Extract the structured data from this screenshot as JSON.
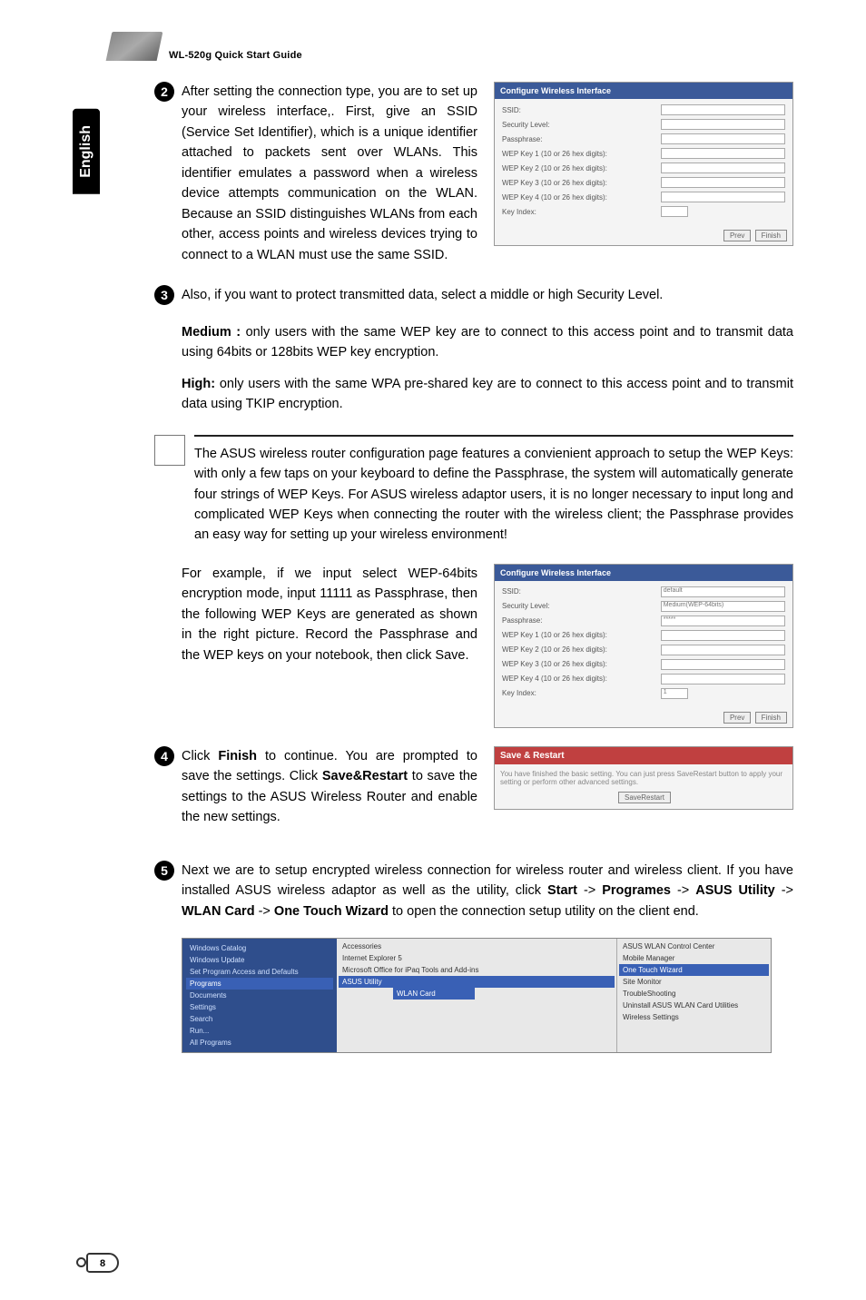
{
  "header": {
    "title": "WL-520g Quick Start Guide"
  },
  "sideTab": "English",
  "step2": {
    "para": "After setting the connection type, you are to set up your wireless interface,. First, give an SSID (Service Set Identifier), which is a unique identifier attached to packets sent over WLANs. This identifier emulates a password when a wireless device attempts communication on the WLAN. Because an SSID distinguishes WLANs from each other, access points and wireless devices trying to connect to a WLAN must use the same SSID."
  },
  "shot2": {
    "header": "Configure Wireless Interface",
    "labels": [
      "SSID:",
      "Security Level:",
      "Passphrase:",
      "WEP Key 1 (10 or 26 hex digits):",
      "WEP Key 2 (10 or 26 hex digits):",
      "WEP Key 3 (10 or 26 hex digits):",
      "WEP Key 4 (10 or 26 hex digits):",
      "Key Index:"
    ],
    "btnPrev": "Prev",
    "btnFinish": "Finish"
  },
  "step3": {
    "intro": "Also, if you want to protect transmitted data, select a middle or high Security Level.",
    "medium_lead": "Medium :",
    "medium": " only users with the same WEP key are to connect to this access point and to transmit data using 64bits or 128bits WEP key encryption.",
    "high_lead": "High:",
    "high": " only users with the same WPA pre-shared key are to connect to this access point and to transmit data using TKIP encryption."
  },
  "note": "The ASUS wireless router configuration page features a convienient approach to setup the WEP Keys: with only a few taps on your keyboard to define the Passphrase, the system will automatically generate four strings of WEP Keys. For ASUS wireless adaptor users, it is no longer necessary to input long and complicated WEP Keys when connecting the router with the wireless client; the Passphrase provides an easy way for setting up your wireless environment!",
  "example": "For example, if we input select WEP-64bits encryption mode, input 11111 as Passphrase, then the following WEP Keys are generated as shown in the right picture. Record the Passphrase and the WEP keys on your notebook, then click Save.",
  "shot3": {
    "header": "Configure Wireless Interface",
    "labels": [
      "SSID:",
      "Security Level:",
      "Passphrase:",
      "WEP Key 1 (10 or 26 hex digits):",
      "WEP Key 2 (10 or 26 hex digits):",
      "WEP Key 3 (10 or 26 hex digits):",
      "WEP Key 4 (10 or 26 hex digits):",
      "Key Index:"
    ],
    "btnPrev": "Prev",
    "btnFinish": "Finish",
    "saveHeader": "Save & Restart",
    "btnSave": "SaveRestart"
  },
  "step4_a": "Click ",
  "step4_b": " to continue. You are prompted to save the settings. Click ",
  "step4_c": " to save the settings to the ASUS Wireless Router and enable the new settings.",
  "bold_finish": "Finish",
  "bold_sr": "Save&Restart",
  "step5_a": "Next we are to setup encrypted wireless connection for wireless router and wireless client. If you have installed ASUS wireless adaptor as well as the utility, click ",
  "step5_start": "Start",
  "step5_arrow1": " -> ",
  "step5_programes": "Programes",
  "step5_arrow2": " -> ",
  "step5_asus": "ASUS Utility",
  "step5_arrow3": " -> ",
  "step5_wlan": "WLAN Card",
  "step5_arrow4": " -> ",
  "step5_otw": "One Touch Wizard",
  "step5_end": " to open the connection setup utility on the client end.",
  "tree": {
    "left": [
      "Windows Catalog",
      "Windows Update",
      "Set Program Access and Defaults",
      "Programs",
      "Documents",
      "Settings",
      "Search",
      "Run...",
      "All Programs"
    ],
    "mid": [
      "Accessories",
      "Internet Explorer 5",
      "Microsoft Office for iPaq Tools and Add-ins",
      "ASUS Utility"
    ],
    "midSel": "WLAN Card",
    "right": [
      "ASUS WLAN Control Center",
      "Mobile Manager",
      "One Touch Wizard",
      "Site Monitor",
      "TroubleShooting",
      "Uninstall ASUS WLAN Card Utilities",
      "Wireless Settings"
    ]
  },
  "pageNum": "8"
}
